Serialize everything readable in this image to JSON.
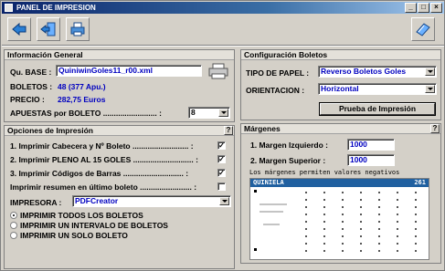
{
  "window": {
    "title": "PANEL DE IMPRESION"
  },
  "info": {
    "title": "Información General",
    "base_label": "Qu. BASE :",
    "base_value": "QuiniwinGoles11_r00.xml",
    "boletos_label": "BOLETOS :",
    "boletos_value": "48 (377 Apu.)",
    "precio_label": "PRECIO :",
    "precio_value": "282,75 Euros",
    "apuestas_label": "APUESTAS por BOLETO ......................... :",
    "apuestas_value": "8"
  },
  "opciones": {
    "title": "Opciones de Impresión",
    "help": "?",
    "checks": [
      {
        "label": "1. Imprimir Cabecera y Nº Boleto .......................... :",
        "checked": "✓"
      },
      {
        "label": "2. Imprimir PLENO AL 15 GOLES ............................ :",
        "checked": "✓"
      },
      {
        "label": "3. Imprimir Códigos de Barras ............................ :",
        "checked": "✓"
      },
      {
        "label": "Imprimir resumen en último boleto ........................ :",
        "checked": ""
      }
    ],
    "impresora_label": "IMPRESORA :",
    "impresora_value": "PDFCreator",
    "radios": [
      "IMPRIMIR TODOS LOS BOLETOS",
      "IMPRIMIR UN INTERVALO DE BOLETOS",
      "IMPRIMIR UN SOLO BOLETO"
    ]
  },
  "config": {
    "title": "Configuración Boletos",
    "tipo_label": "TIPO DE PAPEL :",
    "tipo_value": "Reverso Boletos Goles",
    "orient_label": "ORIENTACION :",
    "orient_value": "Horizontal",
    "prueba_button": "Prueba de Impresión"
  },
  "margenes": {
    "title": "Márgenes",
    "help": "?",
    "izq_label": "1. Margen Izquierdo :",
    "izq_value": "1000",
    "sup_label": "2. Margen Superior :",
    "sup_value": "1000",
    "note": "Los márgenes permiten valores negativos",
    "preview_title": "QUINIELA",
    "preview_number": "261"
  }
}
